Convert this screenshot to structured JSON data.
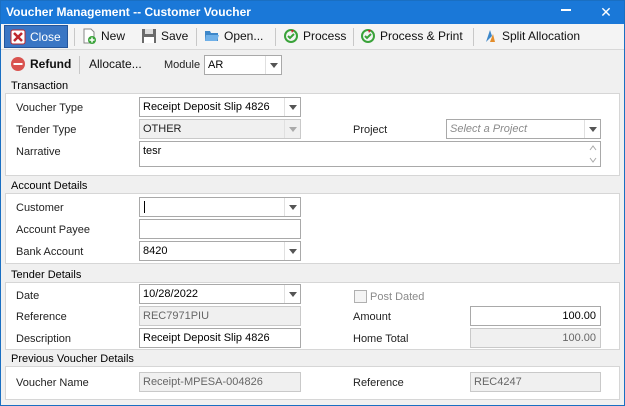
{
  "window": {
    "title": "Voucher Management -- Customer Voucher",
    "close_glyph": "✕"
  },
  "toolbar": {
    "close_label": "Close",
    "new_label": "New",
    "save_label": "Save",
    "open_label": "Open...",
    "process_label": "Process",
    "process_print_label": "Process & Print",
    "split_allocation_label": "Split Allocation"
  },
  "toolbar2": {
    "refund_label": "Refund",
    "allocate_label": "Allocate...",
    "module_label": "Module",
    "module_value": "AR"
  },
  "transaction": {
    "title": "Transaction",
    "voucher_type_label": "Voucher Type",
    "voucher_type_value": "Receipt Deposit Slip 4826",
    "tender_type_label": "Tender Type",
    "tender_type_value": "OTHER",
    "project_label": "Project",
    "project_placeholder": "Select a Project",
    "narrative_label": "Narrative",
    "narrative_value": "tesr"
  },
  "account": {
    "title": "Account Details",
    "customer_label": "Customer",
    "customer_value": "",
    "payee_label": "Account Payee",
    "payee_value": "",
    "bank_label": "Bank Account",
    "bank_value": "8420"
  },
  "tender": {
    "title": "Tender Details",
    "date_label": "Date",
    "date_value": "10/28/2022",
    "post_dated_label": "Post Dated",
    "reference_label": "Reference",
    "reference_value": "REC7971PIU",
    "amount_label": "Amount",
    "amount_value": "100.00",
    "description_label": "Description",
    "description_value": "Receipt Deposit Slip 4826",
    "home_total_label": "Home Total",
    "home_total_value": "100.00"
  },
  "previous": {
    "title": "Previous Voucher Details",
    "voucher_name_label": "Voucher Name",
    "voucher_name_value": "Receipt-MPESA-004826",
    "reference_label": "Reference",
    "reference_value": "REC4247"
  }
}
